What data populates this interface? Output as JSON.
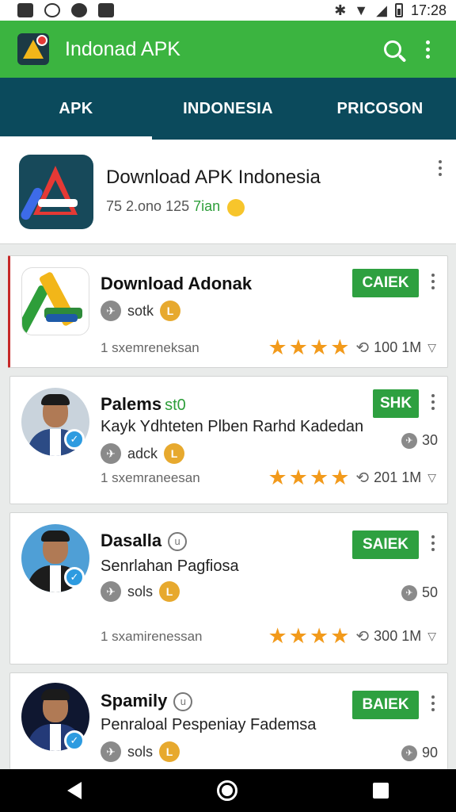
{
  "status_bar": {
    "time": "17:28"
  },
  "app_bar": {
    "title": "Indonad APK"
  },
  "tabs": [
    {
      "label": "APK",
      "active": true
    },
    {
      "label": "INDONESIA",
      "active": false
    },
    {
      "label": "PRICOSON",
      "active": false
    }
  ],
  "featured": {
    "title": "Download APK Indonesia",
    "meta": "75 2.ono 125",
    "meta_green": "7ian"
  },
  "cards": [
    {
      "name": "Download Adonak",
      "name_suffix": "",
      "subtitle": "",
      "tag": "sotk",
      "button": "CAIEK",
      "count": "",
      "subcount": "1 sxemreneksan",
      "stars": 4,
      "downloads": "100 1M"
    },
    {
      "name": "Palems",
      "name_suffix": "st0",
      "subtitle": "Kayk Ydhteten Plben Rarhd Kadedan",
      "tag": "adck",
      "button": "SHK",
      "count": "30",
      "subcount": "1 sxemraneesan",
      "stars": 4,
      "downloads": "201 1M"
    },
    {
      "name": "Dasalla",
      "name_suffix": "",
      "subtitle": "Senrlahan Pagfiosa",
      "tag": "sols",
      "button": "SAIEK",
      "count": "50",
      "subcount": "1 sxamirenessan",
      "stars": 4,
      "downloads": "300 1M"
    },
    {
      "name": "Spamily",
      "name_suffix": "",
      "subtitle": "Penraloal Pespeniay Fademsa",
      "tag": "sols",
      "button": "BAIEK",
      "count": "90",
      "subcount": "",
      "stars": 0,
      "downloads": ""
    }
  ],
  "icons": {
    "status_left": [
      "gallery-icon",
      "gauge-icon",
      "app-icon",
      "chart-icon"
    ],
    "status_right": [
      "bluetooth-icon",
      "wifi-icon",
      "signal-icon",
      "battery-icon"
    ],
    "verified": "check-badge-icon",
    "star": "star-icon"
  },
  "colors": {
    "app_bar": "#3bb440",
    "tab_bar": "#0b4a5c",
    "button_green": "#2ea040",
    "star": "#f29a1b",
    "verified_blue": "#2d9be0",
    "first_card_accent": "#c62828"
  }
}
